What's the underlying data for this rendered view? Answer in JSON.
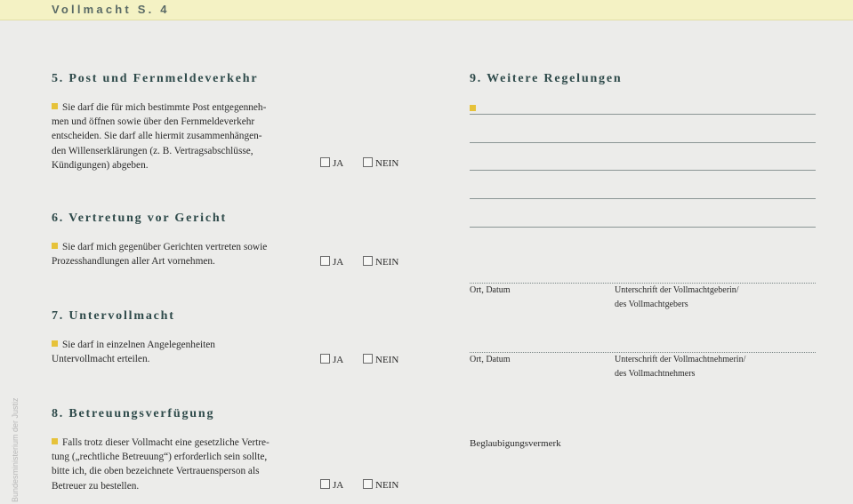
{
  "header": {
    "title": "Vollmacht   S. 4"
  },
  "side_text": "Bundesministerium der Justiz",
  "sections": {
    "s5": {
      "heading": "5. Post und Fernmeldeverkehr",
      "lines": [
        "Sie darf die für mich bestimmte Post entgegenneh-",
        "men und öffnen sowie über den Fernmeldeverkehr",
        "entscheiden. Sie darf alle hiermit zusammenhängen-",
        "den Willenserklärungen (z. B. Vertragsabschlüsse,",
        "Kündigungen) abgeben."
      ]
    },
    "s6": {
      "heading": "6. Vertretung vor Gericht",
      "lines": [
        "Sie darf mich gegenüber Gerichten vertreten sowie",
        "Prozesshandlungen aller Art vornehmen."
      ]
    },
    "s7": {
      "heading": "7. Untervollmacht",
      "lines": [
        "Sie darf in einzelnen Angelegenheiten",
        "Untervollmacht erteilen."
      ]
    },
    "s8": {
      "heading": "8. Betreuungsverfügung",
      "lines": [
        "Falls trotz dieser Vollmacht eine gesetzliche Vertre-",
        "tung („rechtliche Betreuung“) erforderlich sein sollte,",
        "bitte ich, die oben bezeichnete Vertrauensperson als",
        "Betreuer zu bestellen."
      ]
    },
    "s9": {
      "heading": "9. Weitere Regelungen"
    }
  },
  "choices": {
    "ja": "JA",
    "nein": "NEIN"
  },
  "signatures": {
    "ort_datum": "Ort, Datum",
    "giver_line1": "Unterschrift der Vollmachtgeberin/",
    "giver_line2": "des Vollmachtgebers",
    "taker_line1": "Unterschrift der Vollmachtnehmerin/",
    "taker_line2": "des Vollmachtnehmers",
    "beglaubigung": "Beglaubigungsvermerk"
  }
}
